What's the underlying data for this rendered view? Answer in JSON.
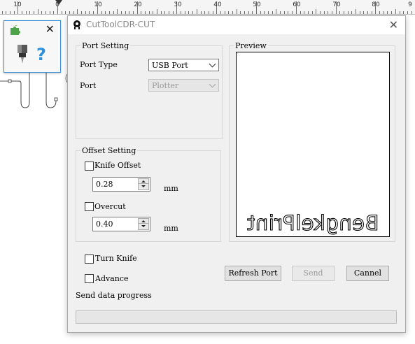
{
  "ruler": {
    "labels": [
      "10",
      "0",
      "10",
      "20",
      "30",
      "40",
      "50",
      "60",
      "70",
      "80",
      "9"
    ]
  },
  "dialog": {
    "title": "CutToolCDR-CUT",
    "port_setting": {
      "legend": "Port Setting",
      "port_type_label": "Port Type",
      "port_type_value": "USB Port",
      "port_label": "Port",
      "port_value": "Plotter"
    },
    "offset_setting": {
      "legend": "Offset Setting",
      "knife_offset_label": "Knife Offset",
      "knife_offset_value": "0.28",
      "knife_offset_unit": "mm",
      "overcut_label": "Overcut",
      "overcut_value": "0.40",
      "overcut_unit": "mm"
    },
    "preview": {
      "legend": "Preview",
      "text": "BengkelPrint"
    },
    "turn_knife_label": "Turn Knife",
    "advance_label": "Advance",
    "buttons": {
      "refresh": "Refresh Port",
      "send": "Send",
      "cancel": "Cannel"
    },
    "progress_label": "Send data progress",
    "progress": 0
  },
  "colors": {
    "accent": "#3c8fd6",
    "dialog_bg": "#f0f0f0"
  },
  "icons": {
    "mini_window": [
      "puzzle-icon",
      "close-icon",
      "cutter-knife-icon",
      "help-icon"
    ],
    "dialog": [
      "app-logo-icon",
      "close-icon"
    ]
  }
}
